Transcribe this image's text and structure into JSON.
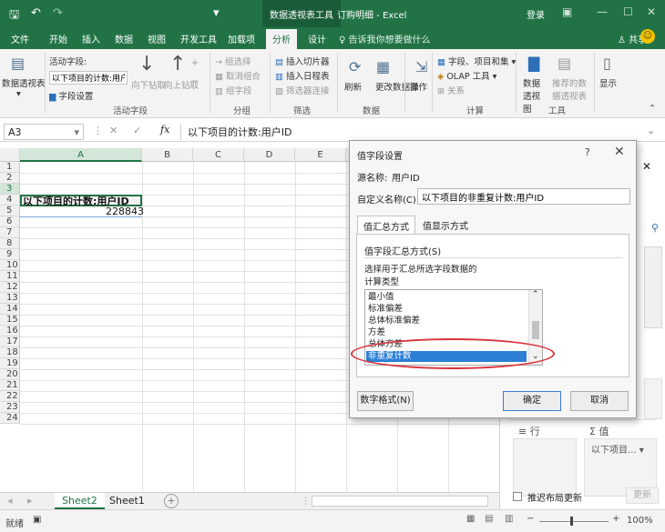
{
  "titlebar": {
    "context_tab": "数据透视表工具",
    "doc_title": "订购明细 - Excel",
    "login": "登录"
  },
  "tabs": [
    "文件",
    "开始",
    "插入",
    "数据",
    "视图",
    "开发工具",
    "加载项",
    "分析",
    "设计"
  ],
  "active_tab": "分析",
  "tell_me": "♀ 告诉我你想要做什么",
  "share": "共享",
  "ribbon": {
    "pivot_table": "数据透视表",
    "active_field_label": "活动字段:",
    "active_field_value": "以下项目的计数:用户I",
    "field_settings": "字段设置",
    "drill_down": "向下钻取",
    "drill_up": "向上钻取",
    "group_active_field": "活动字段",
    "group_selection": "→ 组选择",
    "ungroup": "取消组合",
    "group_field": "组字段",
    "group_group": "分组",
    "insert_slicer": "插入切片器",
    "insert_timeline": "插入日程表",
    "filter_connections": "筛选器连接",
    "group_filter": "筛选",
    "refresh": "刷新",
    "change_source": "更改数据源",
    "group_data": "数据",
    "actions": "操作",
    "fields_items": "字段、项目和集",
    "olap": "OLAP 工具",
    "relationships": "关系",
    "group_calc": "计算",
    "pivot_chart": "数据透视图",
    "recommended": "推荐的数据透视表",
    "group_tools": "工具",
    "show": "显示"
  },
  "formula_bar": {
    "name_box": "A3",
    "fx": "fx",
    "formula": "以下项目的计数:用户ID"
  },
  "grid": {
    "columns": [
      "A",
      "B",
      "C",
      "D",
      "E"
    ],
    "rows": [
      "1",
      "2",
      "3",
      "4",
      "5",
      "6",
      "7",
      "8",
      "9",
      "10",
      "11",
      "12",
      "13",
      "14",
      "15",
      "16",
      "17",
      "18",
      "19",
      "20",
      "21",
      "22",
      "23",
      "24"
    ],
    "a3": "以下项目的计数:用户ID",
    "a4": "228843"
  },
  "sheets": [
    "Sheet2",
    "Sheet1"
  ],
  "active_sheet": "Sheet2",
  "status": {
    "ready": "就绪",
    "zoom": "100%"
  },
  "pane": {
    "rows_label": "≡ 行",
    "values_label": "Σ 值",
    "values_item": "以下项目...",
    "defer_update": "推迟布局更新",
    "update": "更新"
  },
  "dialog": {
    "title": "值字段设置",
    "question": "?",
    "source_name_label": "源名称:",
    "source_name": "用户ID",
    "custom_name_label": "自定义名称(C):",
    "custom_name": "以下项目的非重复计数:用户ID",
    "tab_summarize": "值汇总方式",
    "tab_show_as": "值显示方式",
    "summarize_by_label": "值字段汇总方式(S)",
    "choose_desc": "选择用于汇总所选字段数据的",
    "calc_type": "计算类型",
    "list_items": [
      "最小值",
      "标准偏差",
      "总体标准偏差",
      "方差",
      "总体方差",
      "非重复计数"
    ],
    "selected_item": "非重复计数",
    "number_format": "数字格式(N)",
    "ok": "确定",
    "cancel": "取消"
  },
  "colors": {
    "excel_green": "#217346",
    "selection_blue": "#2d7fd6",
    "annotation_red": "#d9333c"
  }
}
